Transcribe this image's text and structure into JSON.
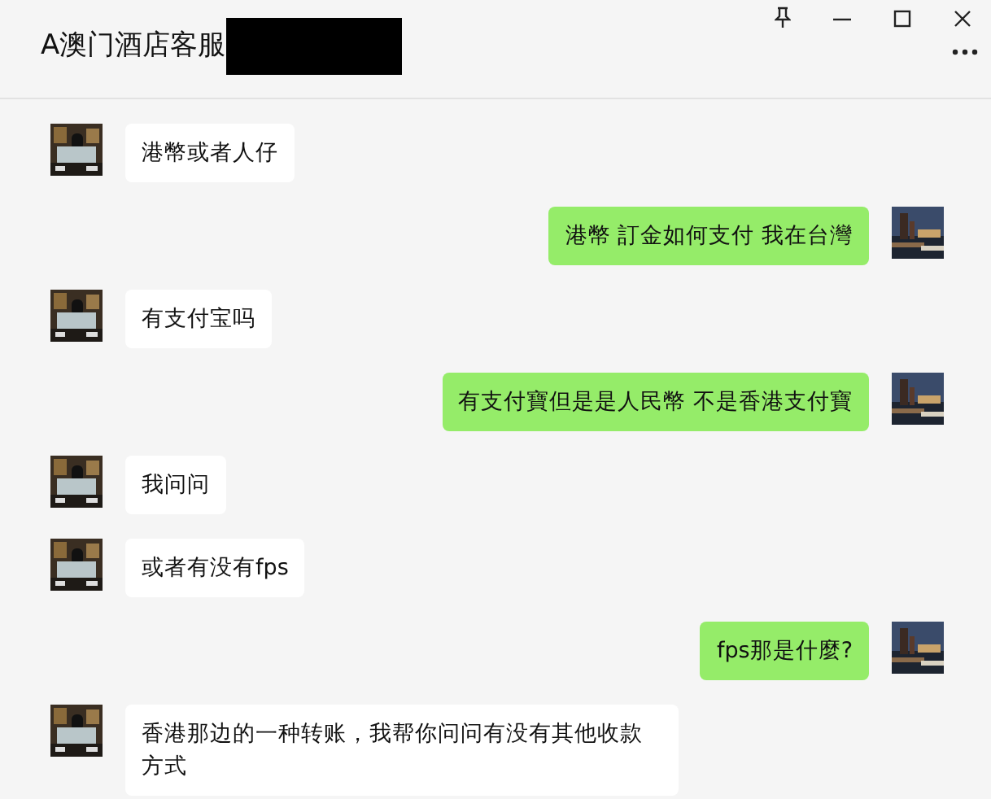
{
  "window": {
    "title": "A澳门酒店客服",
    "redacted": true
  },
  "messages": [
    {
      "kind": "received",
      "text": "港幣或者人仔"
    },
    {
      "kind": "sent",
      "text": "港幣 訂金如何支付 我在台灣"
    },
    {
      "kind": "received",
      "text": "有支付宝吗"
    },
    {
      "kind": "sent",
      "text": "有支付寶但是是人民幣  不是香港支付寶"
    },
    {
      "kind": "received",
      "text": "我问问"
    },
    {
      "kind": "received",
      "text": "或者有没有fps"
    },
    {
      "kind": "sent",
      "text": "fps那是什麼?"
    },
    {
      "kind": "received",
      "text": "香港那边的一种转账，我帮你问问有没有其他收款方式"
    }
  ]
}
